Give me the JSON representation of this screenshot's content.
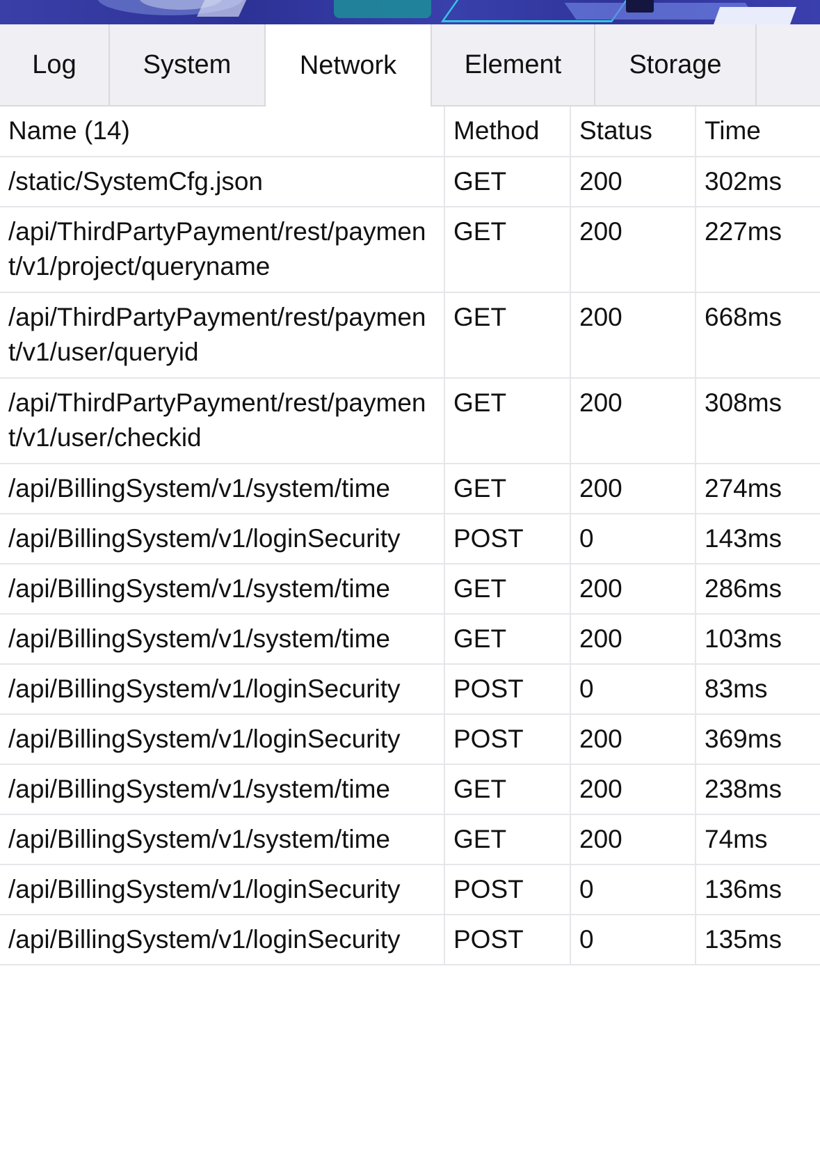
{
  "tabs": [
    {
      "label": "Log",
      "active": false
    },
    {
      "label": "System",
      "active": false
    },
    {
      "label": "Network",
      "active": true
    },
    {
      "label": "Element",
      "active": false
    },
    {
      "label": "Storage",
      "active": false
    }
  ],
  "network": {
    "header": {
      "name": "Name (14)",
      "method": "Method",
      "status": "Status",
      "time": "Time"
    },
    "requests": [
      {
        "name": "/static/SystemCfg.json",
        "method": "GET",
        "status": "200",
        "time": "302ms"
      },
      {
        "name": "/api/ThirdPartyPayment/rest/payment/v1/project/queryname",
        "method": "GET",
        "status": "200",
        "time": "227ms"
      },
      {
        "name": "/api/ThirdPartyPayment/rest/payment/v1/user/queryid",
        "method": "GET",
        "status": "200",
        "time": "668ms"
      },
      {
        "name": "/api/ThirdPartyPayment/rest/payment/v1/user/checkid",
        "method": "GET",
        "status": "200",
        "time": "308ms"
      },
      {
        "name": "/api/BillingSystem/v1/system/time",
        "method": "GET",
        "status": "200",
        "time": "274ms"
      },
      {
        "name": "/api/BillingSystem/v1/loginSecurity",
        "method": "POST",
        "status": "0",
        "time": "143ms"
      },
      {
        "name": "/api/BillingSystem/v1/system/time",
        "method": "GET",
        "status": "200",
        "time": "286ms"
      },
      {
        "name": "/api/BillingSystem/v1/system/time",
        "method": "GET",
        "status": "200",
        "time": "103ms"
      },
      {
        "name": "/api/BillingSystem/v1/loginSecurity",
        "method": "POST",
        "status": "0",
        "time": "83ms"
      },
      {
        "name": "/api/BillingSystem/v1/loginSecurity",
        "method": "POST",
        "status": "200",
        "time": "369ms"
      },
      {
        "name": "/api/BillingSystem/v1/system/time",
        "method": "GET",
        "status": "200",
        "time": "238ms"
      },
      {
        "name": "/api/BillingSystem/v1/system/time",
        "method": "GET",
        "status": "200",
        "time": "74ms"
      },
      {
        "name": "/api/BillingSystem/v1/loginSecurity",
        "method": "POST",
        "status": "0",
        "time": "136ms"
      },
      {
        "name": "/api/BillingSystem/v1/loginSecurity",
        "method": "POST",
        "status": "0",
        "time": "135ms"
      }
    ]
  }
}
